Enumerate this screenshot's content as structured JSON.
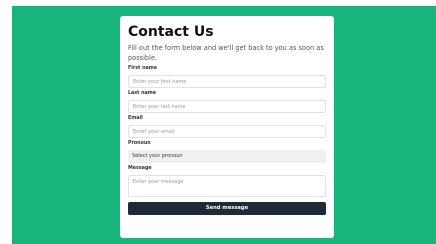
{
  "form": {
    "title": "Contact Us",
    "subtitle": "Fill out the form below and we'll get back to you as soon as possible.",
    "fields": {
      "first_name": {
        "label": "First name",
        "placeholder": "Enter your first name"
      },
      "last_name": {
        "label": "Last name",
        "placeholder": "Enter your last name"
      },
      "email": {
        "label": "Email",
        "placeholder": "Enter your email"
      },
      "pronoun": {
        "label": "Pronoun",
        "value": "Select your pronoun"
      },
      "message": {
        "label": "Message",
        "placeholder": "Enter your message"
      }
    },
    "submit_label": "Send message"
  },
  "colors": {
    "background": "#17b57c",
    "card": "#ffffff",
    "button": "#1f2937"
  }
}
